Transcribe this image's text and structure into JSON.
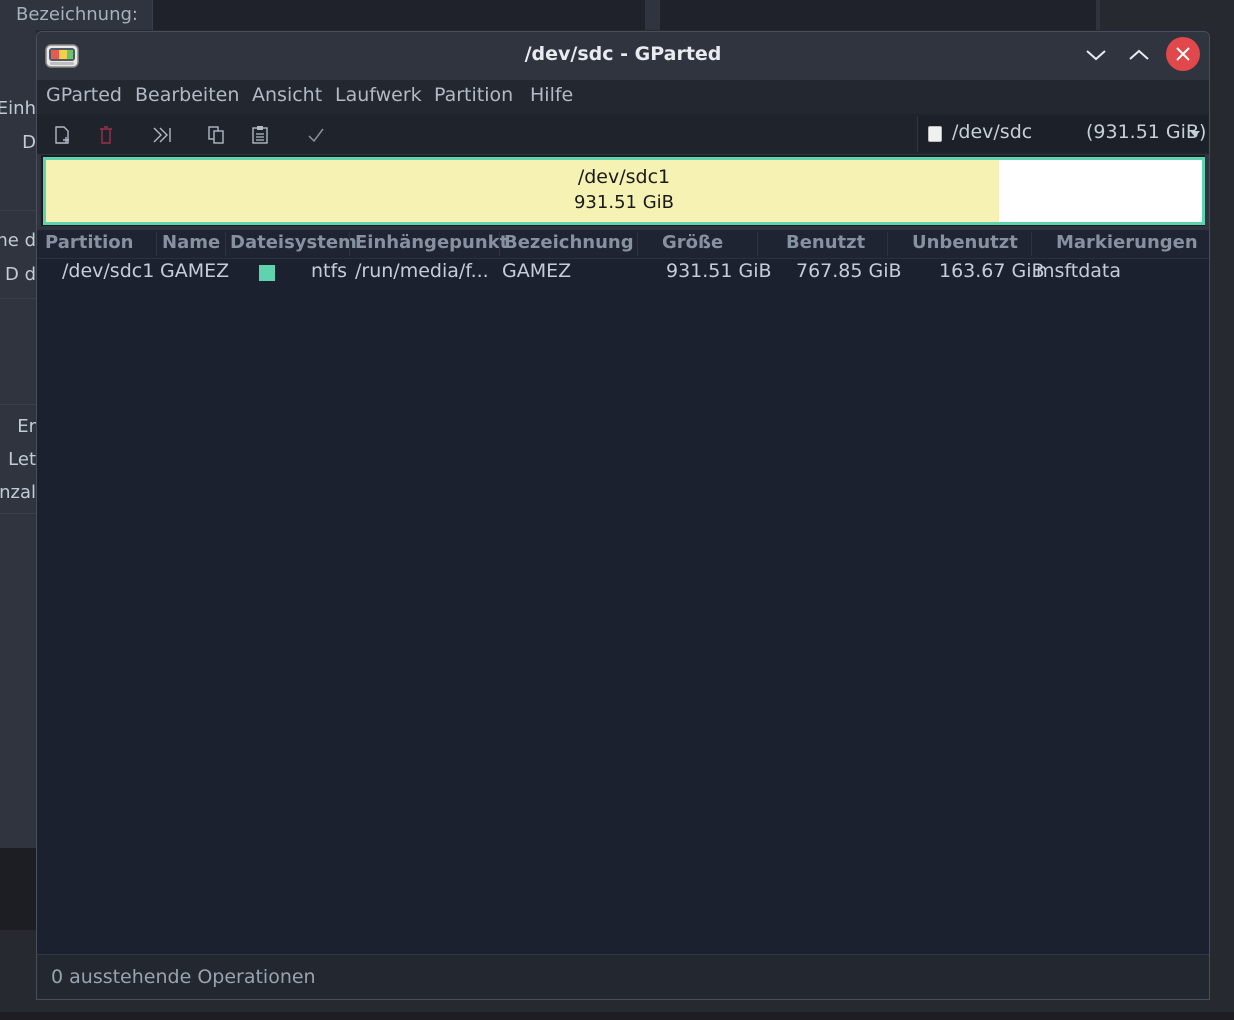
{
  "background_window": {
    "label": "Bezeichnung:",
    "fragments": [
      "Einh",
      "D",
      "ne d",
      "D d",
      "Er",
      "Let",
      "nzal"
    ]
  },
  "window": {
    "title": "/dev/sdc - GParted",
    "app_icon": "gparted-icon",
    "controls": {
      "minimize": "chevron-down-icon",
      "maximize": "chevron-up-icon",
      "close": "close-icon"
    }
  },
  "menu": [
    "GParted",
    "Bearbeiten",
    "Ansicht",
    "Laufwerk",
    "Partition",
    "Hilfe"
  ],
  "toolbar": {
    "tools": [
      "new-partition-icon",
      "delete-icon",
      "resize-move-icon",
      "copy-icon",
      "paste-icon",
      "apply-icon"
    ],
    "device": {
      "name": "/dev/sdc",
      "size": "(931.51 GiB)"
    }
  },
  "disk_map": {
    "partition_name": "/dev/sdc1",
    "partition_size": "931.51 GiB",
    "used_fraction": 0.824,
    "fs_color": "#5fd2b0",
    "used_color": "#f6f2b4"
  },
  "table": {
    "headers": [
      "Partition",
      "Name",
      "Dateisystem",
      "Einhängepunkt",
      "Bezeichnung",
      "Größe",
      "Benutzt",
      "Unbenutzt",
      "Markierungen"
    ],
    "rows": [
      {
        "partition": "/dev/sdc1",
        "name": "GAMEZ",
        "filesystem": "ntfs",
        "mountpoint": "/run/media/f...",
        "label": "GAMEZ",
        "size": "931.51 GiB",
        "used": "767.85 GiB",
        "unused": "163.67 GiB",
        "flags": "msftdata"
      }
    ]
  },
  "status": "0 ausstehende Operationen"
}
